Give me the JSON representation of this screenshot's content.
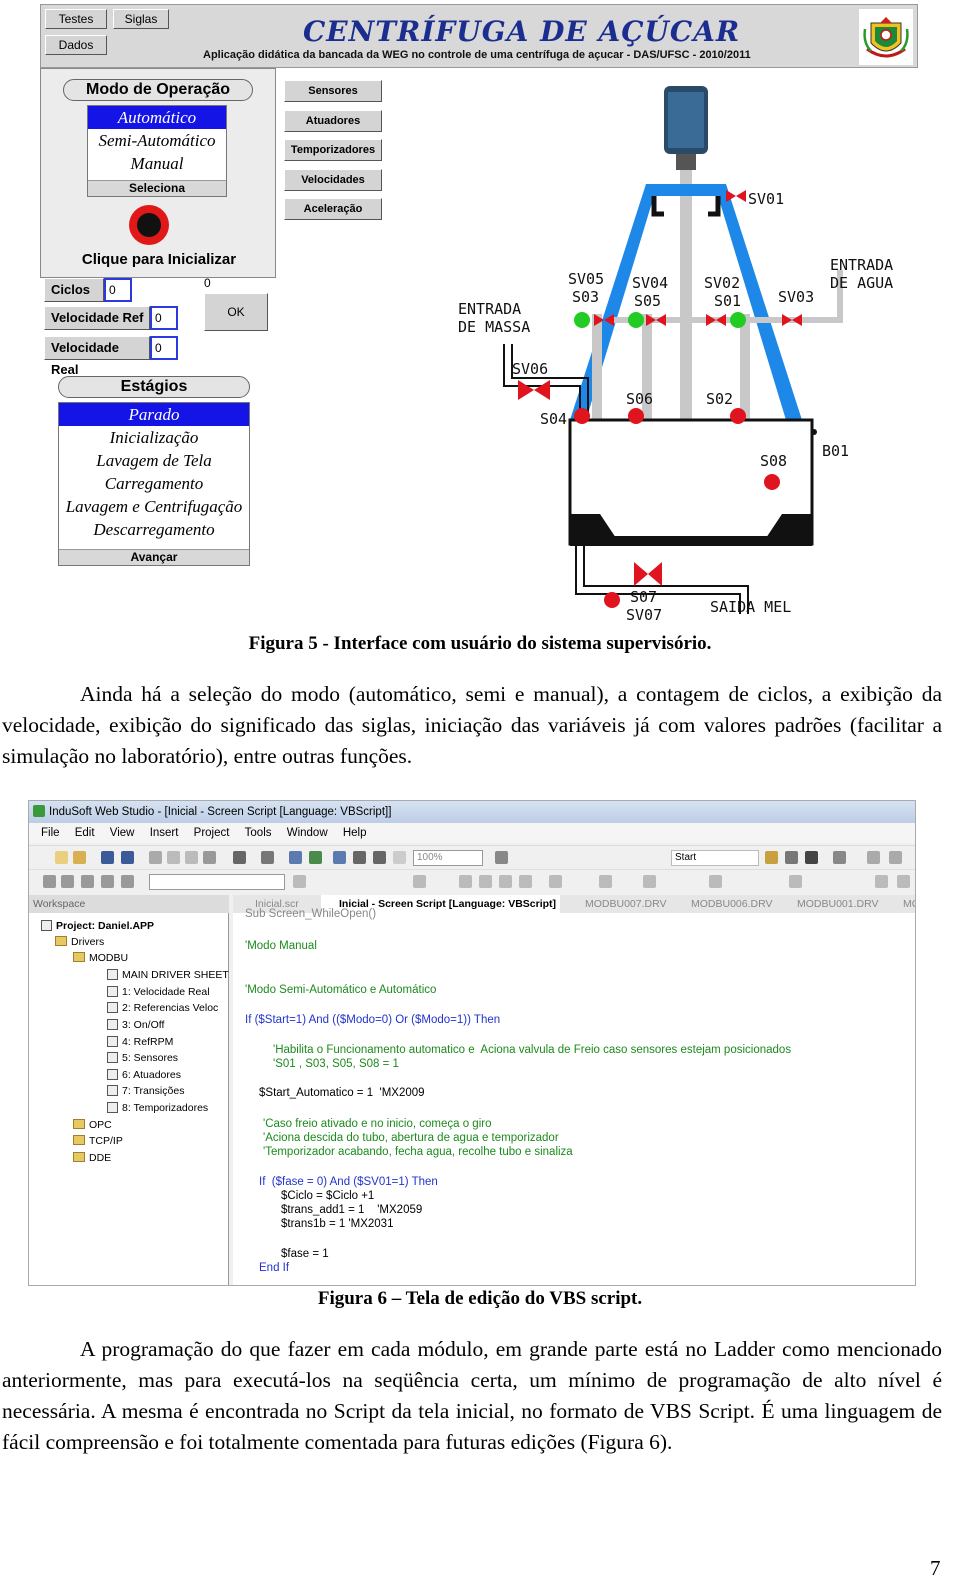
{
  "figure5": {
    "header_buttons": [
      "Testes",
      "Siglas",
      "Dados"
    ],
    "title": "CENTRÍFUGA DE AÇÚCAR",
    "subtitle": "Aplicação didática da bancada da WEG no controle de uma centrífuga de açucar - DAS/UFSC - 2010/2011",
    "mode_panel": {
      "title": "Modo de Operação",
      "options": [
        "Automático",
        "Semi-Automático",
        "Manual"
      ],
      "selected": "Automático",
      "select_button": "Seleciona",
      "start_label": "Clique para Inicializar"
    },
    "side_buttons": [
      "Sensores",
      "Atuadores",
      "Temporizadores",
      "Velocidades",
      "Aceleração"
    ],
    "readouts": [
      {
        "label": "Ciclos",
        "value": "0"
      },
      {
        "label": "Velocidade Ref",
        "value": "0"
      },
      {
        "label": "Velocidade Real",
        "value": "0"
      }
    ],
    "ok_value": "0",
    "ok_button": "OK",
    "stages_panel": {
      "title": "Estágios",
      "options": [
        "Parado",
        "Inicialização",
        "Lavagem de Tela",
        "Carregamento",
        "Lavagem e Centrifugação",
        "Descarregamento"
      ],
      "selected": "Parado",
      "advance_button": "Avançar"
    },
    "diagram_labels": {
      "sv01": "SV01",
      "sv05": "SV05",
      "s03": "S03",
      "sv04": "SV04",
      "s05": "S05",
      "sv02": "SV02",
      "s01": "S01",
      "sv03": "SV03",
      "entrada_agua_1": "ENTRADA",
      "entrada_agua_2": "DE AGUA",
      "entrada_massa_1": "ENTRADA",
      "entrada_massa_2": "DE MASSA",
      "sv06": "SV06",
      "s04": "S04",
      "s06": "S06",
      "s02": "S02",
      "s08": "S08",
      "b01": "B01",
      "s07": "S07",
      "sv07": "SV07",
      "saida_mel": "SAIDA MEL"
    },
    "caption": "Figura 5 - Interface com usuário do sistema supervisório."
  },
  "paragraph1": "Ainda há a seleção do modo (automático, semi e manual), a contagem de ciclos, a exibição da velocidade, exibição do significado das siglas, iniciação das variáveis já com valores padrões (facilitar a simulação no laboratório), entre outras funções.",
  "figure6": {
    "window_title": "InduSoft Web Studio - [Inicial - Screen Script [Language: VBScript]]",
    "menu": [
      "File",
      "Edit",
      "View",
      "Insert",
      "Project",
      "Tools",
      "Window",
      "Help"
    ],
    "zoom": "100%",
    "start_field": "Start",
    "workspace_label": "Workspace",
    "tree": {
      "project": "Project: Daniel.APP",
      "drivers": "Drivers",
      "modbu": "MODBU",
      "sheets": [
        "MAIN DRIVER SHEET",
        "1: Velocidade Real",
        "2: Referencias Veloc",
        "3: On/Off",
        "4: RefRPM",
        "5: Sensores",
        "6: Atuadores",
        "7: Transições",
        "8: Temporizadores"
      ],
      "folders": [
        "OPC",
        "TCP/IP",
        "DDE"
      ]
    },
    "tabs": [
      "Inicial.scr",
      "Inicial - Screen Script [Language: VBScript]",
      "MODBU007.DRV",
      "MODBU006.DRV",
      "MODBU001.DRV",
      "MO"
    ],
    "code": [
      "Sub Screen_WhileOpen()",
      "'Modo Manual",
      "'Modo Semi-Automático e Automático",
      "If ($Start=1) And (($Modo=0) Or ($Modo=1)) Then",
      "'Habilita o Funcionamento automatico e  Aciona valvula de Freio caso sensores estejam posicionados",
      "'S01 , S03, S05, S08 = 1",
      "$Start_Automatico = 1  'MX2009",
      "'Caso freio ativado e no inicio, começa o giro",
      "'Aciona descida do tubo, abertura de agua e temporizador",
      "'Temporizador acabando, fecha agua, recolhe tubo e sinaliza",
      "If  ($fase = 0) And ($SV01=1) Then",
      "$Ciclo = $Ciclo +1",
      "$trans_add1 = 1    'MX2059",
      "$trans1b = 1 'MX2031",
      "$fase = 1",
      "End If"
    ],
    "caption": "Figura 6 – Tela de edição do VBS script."
  },
  "paragraph2": "A programação do que fazer em cada módulo, em grande parte está no Ladder como mencionado anteriormente, mas para executá-los na seqüência certa, um mínimo de programação de alto nível é necessária. A mesma é encontrada no Script da tela inicial, no formato de VBS Script. É uma linguagem de fácil compreensão e foi totalmente comentada para futuras edições (Figura 6).",
  "page_number": "7",
  "colors": {
    "selection_blue": "#1414e6",
    "pipe_blue": "#1e88e8",
    "valve_red": "#e0141e",
    "sensor_green": "#22cc22",
    "title_blue": "#1b2e8f",
    "code_comment": "#1c8a1c",
    "code_keyword": "#2233cc"
  }
}
